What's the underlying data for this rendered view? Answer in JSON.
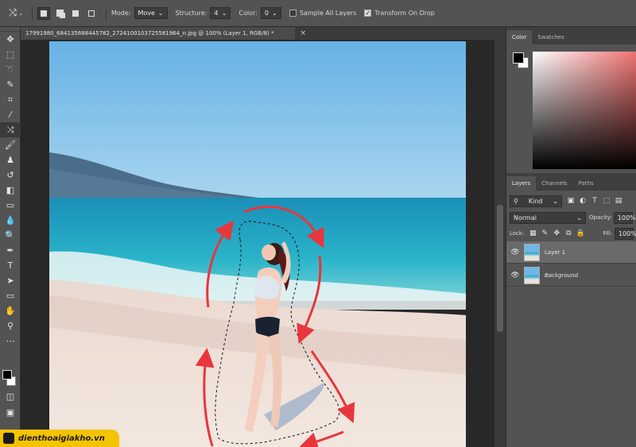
{
  "options_bar": {
    "tool_icon": "content-aware-move-icon",
    "mode_label": "Mode:",
    "mode_value": "Move",
    "structure_label": "Structure:",
    "structure_value": "4",
    "color_label": "Color:",
    "color_value": "0",
    "sample_all_layers_label": "Sample All Layers",
    "sample_all_layers_checked": false,
    "transform_on_drop_label": "Transform On Drop",
    "transform_on_drop_checked": true
  },
  "document_tab": {
    "title": "17991980_684135688445782_2724100103725581964_n.jpg @ 100% (Layer 1, RGB/8) *",
    "close": "×"
  },
  "toolbox": {
    "tools": [
      "move-icon",
      "marquee-icon",
      "lasso-icon",
      "quick-select-icon",
      "crop-icon",
      "eyedropper-icon",
      "content-aware-move-icon",
      "brush-icon",
      "stamp-icon",
      "history-brush-icon",
      "eraser-icon",
      "gradient-icon",
      "blur-icon",
      "dodge-icon",
      "pen-icon",
      "type-icon",
      "path-select-icon",
      "rectangle-icon",
      "hand-icon",
      "zoom-icon",
      "more-icon"
    ]
  },
  "color_panel": {
    "tabs": [
      "Color",
      "Swatches"
    ],
    "active_tab": "Color",
    "foreground": "#000000",
    "background": "#ffffff",
    "hue": "#f07070"
  },
  "layers_panel": {
    "tabs": [
      "Layers",
      "Channels",
      "Paths"
    ],
    "active_tab": "Layers",
    "filter_label": "Kind",
    "blend_mode": "Normal",
    "opacity_label": "Opacity:",
    "opacity_value": "100%",
    "lock_label": "Lock:",
    "fill_label": "Fill:",
    "fill_value": "100%",
    "layers": [
      {
        "name": "Layer 1",
        "visible": true,
        "selected": true
      },
      {
        "name": "Background",
        "visible": true,
        "selected": false
      }
    ]
  },
  "watermark": {
    "text": "dienthoaigiakho.vn"
  }
}
